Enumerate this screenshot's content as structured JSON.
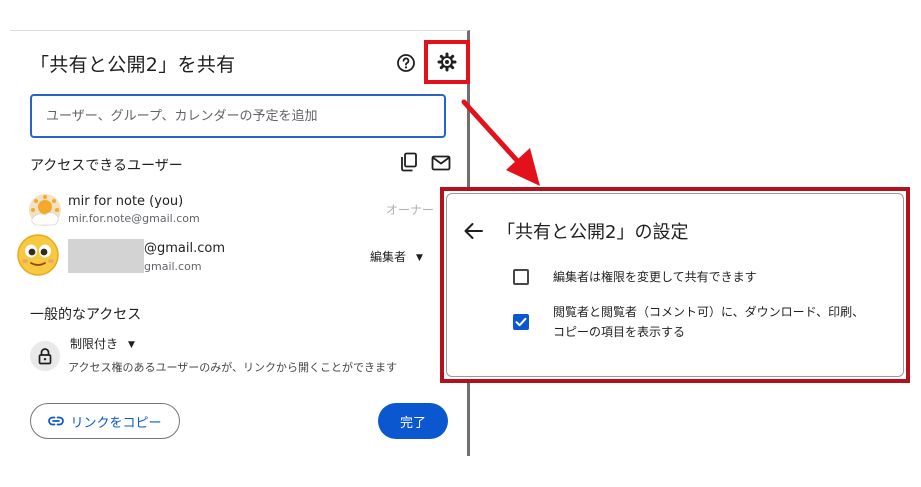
{
  "share_dialog": {
    "title": "「共有と公開2」を共有",
    "people_input_placeholder": "ユーザー、グループ、カレンダーの予定を追加",
    "access_section_title": "アクセスできるユーザー",
    "users": [
      {
        "name": "mir for note (you)",
        "email": "mir.for.note@gmail.com",
        "role": "オーナー"
      },
      {
        "name": "@gmail.com",
        "email": "gmail.com",
        "role": "編集者"
      }
    ],
    "general_access_title": "一般的なアクセス",
    "general_access_value": "制限付き",
    "general_access_desc": "アクセス権のあるユーザーのみが、リンクから開くことができます",
    "copy_link_label": "リンクをコピー",
    "done_label": "完了",
    "caret": "▼"
  },
  "settings_panel": {
    "title": "「共有と公開2」の設定",
    "options": [
      {
        "text": "編集者は権限を変更して共有できます",
        "checked": false
      },
      {
        "text_line1": "閲覧者と閲覧者（コメント可）に、ダウンロード、印刷、",
        "text_line2": "コピーの項目を表示する",
        "checked": true
      }
    ]
  },
  "colors": {
    "highlight_red": "#e3111b",
    "panel_border": "#b1121b",
    "accent_blue": "#0b57d0"
  },
  "icons": [
    "help-icon",
    "gear-icon",
    "copy-icon",
    "mail-icon",
    "lock-icon",
    "link-icon",
    "back-arrow-icon",
    "checkmark-icon"
  ]
}
